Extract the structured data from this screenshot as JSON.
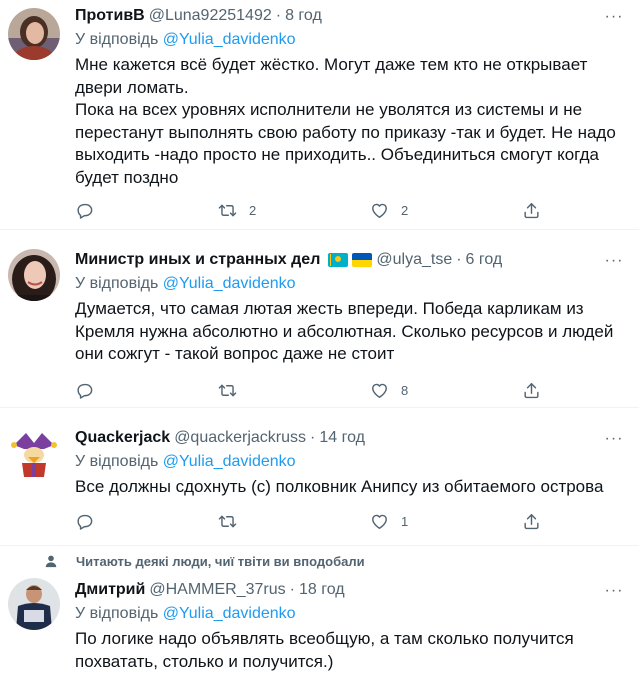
{
  "tweets": [
    {
      "name": "ПротивВ",
      "handle": "@Luna92251492",
      "dot": "·",
      "time": "8 год",
      "reply_prefix": "У відповідь",
      "reply_to": "@Yulia_davidenko",
      "paragraphs": [
        "Мне кажется всё будет жёстко. Могут даже тем кто не открывает двери ломать.",
        "Пока на всех уровнях исполнители не уволятся из системы и не перестанут выполнять свою работу по приказу -так и будет. Не надо выходить -надо просто не приходить.. Объединиться смогут когда будет поздно"
      ],
      "retweets": "2",
      "likes": "2"
    },
    {
      "name": "Министр иных и странных дел",
      "handle": "@ulya_tse",
      "dot": "·",
      "time": "6 год",
      "reply_prefix": "У відповідь",
      "reply_to": "@Yulia_davidenko",
      "paragraphs": [
        "Думается, что самая лютая жесть впереди. Победа карликам из Кремля нужна абсолютно и абсолютная. Сколько ресурсов и людей они сожгут - такой вопрос даже не стоит"
      ],
      "retweets": "",
      "likes": "8"
    },
    {
      "name": "Quackerjack",
      "handle": "@quackerjackruss",
      "dot": "·",
      "time": "14 год",
      "reply_prefix": "У відповідь",
      "reply_to": "@Yulia_davidenko",
      "paragraphs": [
        "Все должны сдохнуть (с) полковник Анипсу из обитаемого острова"
      ],
      "retweets": "",
      "likes": "1"
    },
    {
      "liked_by": "Читають деякі люди, чиї твіти ви вподобали",
      "name": "Дмитрий",
      "handle": "@HAMMER_37rus",
      "dot": "·",
      "time": "18 год",
      "reply_prefix": "У відповідь",
      "reply_to": "@Yulia_davidenko",
      "paragraphs": [
        "По логике надо объявлять всеобщую, а там сколько получится похватать, столько и получится.)"
      ]
    }
  ],
  "icons": {
    "reply": "reply-icon",
    "retweet": "retweet-icon",
    "like": "heart-icon",
    "share": "share-icon",
    "more": "more-icon"
  },
  "colors": {
    "mention": "#1d9bf0",
    "secondary": "#536471",
    "text": "#0f1419",
    "divider": "#eff3f4"
  }
}
